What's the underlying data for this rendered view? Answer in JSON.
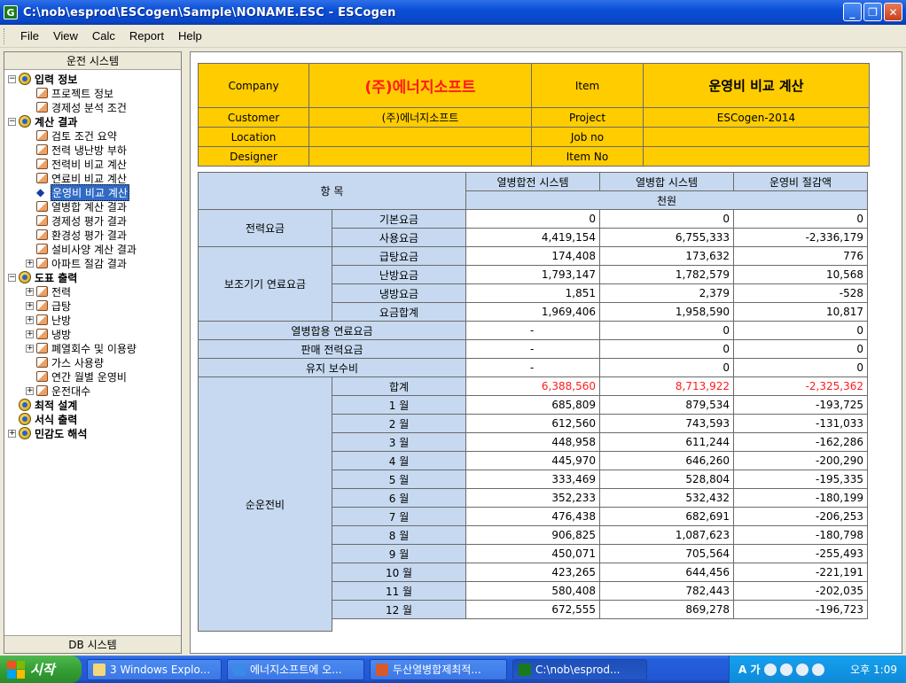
{
  "window": {
    "title": "C:\\nob\\esprod\\ESCogen\\Sample\\NONAME.ESC - ESCogen",
    "app_icon": "G"
  },
  "menu": [
    "File",
    "View",
    "Calc",
    "Report",
    "Help"
  ],
  "left_panel": {
    "header": "운전 시스템",
    "footer": "DB 시스템",
    "tree": [
      {
        "label": "입력 정보",
        "level": 0,
        "type": "group",
        "bold": true,
        "expander": "−"
      },
      {
        "label": "프로젝트 정보",
        "level": 1,
        "type": "doc"
      },
      {
        "label": "경제성 분석 조건",
        "level": 1,
        "type": "doc"
      },
      {
        "label": "계산 결과",
        "level": 0,
        "type": "group",
        "bold": true,
        "expander": "−"
      },
      {
        "label": "검토 조건 요약",
        "level": 1,
        "type": "doc"
      },
      {
        "label": "전력 냉난방 부하",
        "level": 1,
        "type": "doc"
      },
      {
        "label": "전력비 비교 계산",
        "level": 1,
        "type": "doc"
      },
      {
        "label": "연료비 비교 계산",
        "level": 1,
        "type": "doc"
      },
      {
        "label": "운영비 비교 계산",
        "level": 1,
        "type": "arrow",
        "selected": true
      },
      {
        "label": "열병합 계산 결과",
        "level": 1,
        "type": "doc"
      },
      {
        "label": "경제성 평가 결과",
        "level": 1,
        "type": "doc"
      },
      {
        "label": "환경성 평가 결과",
        "level": 1,
        "type": "doc"
      },
      {
        "label": "설비사양 계산 결과",
        "level": 1,
        "type": "doc"
      },
      {
        "label": "아파트 절감 결과",
        "level": 1,
        "type": "doc",
        "expander": "+"
      },
      {
        "label": "도표 출력",
        "level": 0,
        "type": "group",
        "bold": true,
        "expander": "−"
      },
      {
        "label": "전력",
        "level": 1,
        "type": "doc",
        "expander": "+"
      },
      {
        "label": "급탕",
        "level": 1,
        "type": "doc",
        "expander": "+"
      },
      {
        "label": "난방",
        "level": 1,
        "type": "doc",
        "expander": "+"
      },
      {
        "label": "냉방",
        "level": 1,
        "type": "doc",
        "expander": "+"
      },
      {
        "label": "폐열회수 및 이용량",
        "level": 1,
        "type": "doc",
        "expander": "+"
      },
      {
        "label": "가스 사용량",
        "level": 1,
        "type": "doc"
      },
      {
        "label": "연간 월별 운영비",
        "level": 1,
        "type": "doc"
      },
      {
        "label": "운전대수",
        "level": 1,
        "type": "doc",
        "expander": "+"
      },
      {
        "label": "최적 설계",
        "level": 0,
        "type": "group",
        "bold": true
      },
      {
        "label": "서식 출력",
        "level": 0,
        "type": "group",
        "bold": true
      },
      {
        "label": "민감도 해석",
        "level": 0,
        "type": "group",
        "bold": true,
        "expander": "+"
      }
    ]
  },
  "header_table": {
    "company_label": "Company",
    "company_value": "(주)에너지소프트",
    "item_label": "Item",
    "item_value": "운영비 비교 계산",
    "customer_label": "Customer",
    "customer_value": "(주)에너지소프트",
    "project_label": "Project",
    "project_value": "ESCogen-2014",
    "location_label": "Location",
    "location_value": "",
    "jobno_label": "Job no",
    "jobno_value": "",
    "designer_label": "Designer",
    "designer_value": "",
    "itemno_label": "Item No",
    "itemno_value": ""
  },
  "main_table": {
    "col_item": "항 목",
    "col_a": "열병합전 시스템",
    "col_b": "열병합 시스템",
    "col_c": "운영비 절감액",
    "unit": "천원",
    "groups": [
      {
        "name": "전력요금",
        "rows": [
          {
            "label": "기본요금",
            "a": "0",
            "b": "0",
            "c": "0"
          },
          {
            "label": "사용요금",
            "a": "4,419,154",
            "b": "6,755,333",
            "c": "-2,336,179"
          }
        ]
      },
      {
        "name": "보조기기 연료요금",
        "rows": [
          {
            "label": "급탕요금",
            "a": "174,408",
            "b": "173,632",
            "c": "776"
          },
          {
            "label": "난방요금",
            "a": "1,793,147",
            "b": "1,782,579",
            "c": "10,568"
          },
          {
            "label": "냉방요금",
            "a": "1,851",
            "b": "2,379",
            "c": "-528"
          },
          {
            "label": "요금합계",
            "a": "1,969,406",
            "b": "1,958,590",
            "c": "10,817"
          }
        ]
      }
    ],
    "single_rows": [
      {
        "label": "열병합용 연료요금",
        "a": "-",
        "b": "0",
        "c": "0"
      },
      {
        "label": "판매 전력요금",
        "a": "-",
        "b": "0",
        "c": "0"
      },
      {
        "label": "유지 보수비",
        "a": "-",
        "b": "0",
        "c": "0"
      }
    ],
    "net": {
      "name": "순운전비",
      "total": {
        "label": "합계",
        "a": "6,388,560",
        "b": "8,713,922",
        "c": "-2,325,362"
      },
      "months": [
        {
          "label": "1 월",
          "a": "685,809",
          "b": "879,534",
          "c": "-193,725"
        },
        {
          "label": "2 월",
          "a": "612,560",
          "b": "743,593",
          "c": "-131,033"
        },
        {
          "label": "3 월",
          "a": "448,958",
          "b": "611,244",
          "c": "-162,286"
        },
        {
          "label": "4 월",
          "a": "445,970",
          "b": "646,260",
          "c": "-200,290"
        },
        {
          "label": "5 월",
          "a": "333,469",
          "b": "528,804",
          "c": "-195,335"
        },
        {
          "label": "6 월",
          "a": "352,233",
          "b": "532,432",
          "c": "-180,199"
        },
        {
          "label": "7 월",
          "a": "476,438",
          "b": "682,691",
          "c": "-206,253"
        },
        {
          "label": "8 월",
          "a": "906,825",
          "b": "1,087,623",
          "c": "-180,798"
        },
        {
          "label": "9 월",
          "a": "450,071",
          "b": "705,564",
          "c": "-255,493"
        },
        {
          "label": "10 월",
          "a": "423,265",
          "b": "644,456",
          "c": "-221,191"
        },
        {
          "label": "11 월",
          "a": "580,408",
          "b": "782,443",
          "c": "-202,035"
        },
        {
          "label": "12 월",
          "a": "672,555",
          "b": "869,278",
          "c": "-196,723"
        }
      ]
    }
  },
  "taskbar": {
    "start": "시작",
    "tasks": [
      "3 Windows Explo...",
      "에너지소프트에 오...",
      "두산열병합제최적...",
      "C:\\nob\\esprod..."
    ],
    "tray_ime": "A 가",
    "clock": "오후 1:09"
  },
  "colors": {
    "header_yellow": "#ffcc00",
    "label_blue": "#c6d9f0",
    "negative_total_red": "#ff1a1a",
    "title_blue": "#0a4fd6",
    "selection": "#316ac5"
  }
}
